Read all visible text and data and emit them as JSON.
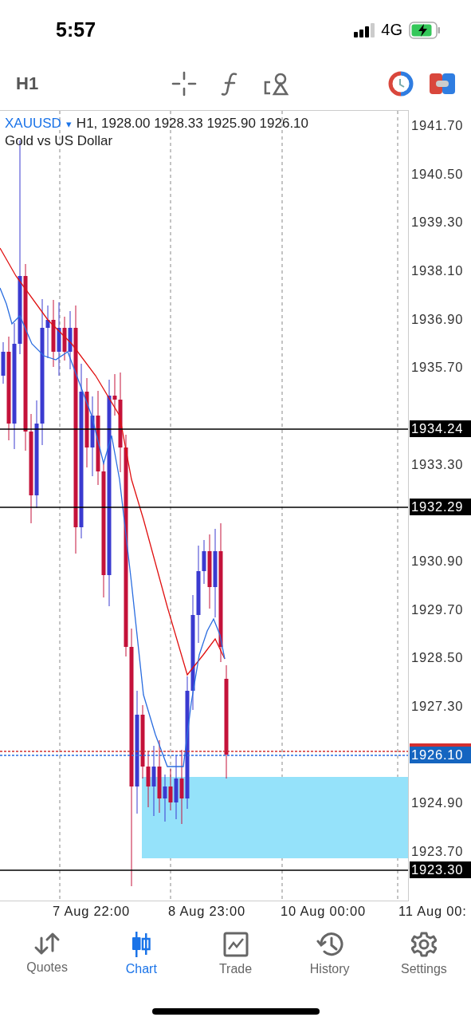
{
  "status_bar": {
    "time": "5:57",
    "network": "4G"
  },
  "toolbar": {
    "timeframe": "H1"
  },
  "chart": {
    "symbol": "XAUUSD",
    "dropdown": "▾",
    "quote": "H1, 1928.00 1928.33 1925.90 1926.10",
    "description": "Gold vs US Dollar",
    "price_ticks": [
      "1941.70",
      "1940.50",
      "1939.30",
      "1938.10",
      "1936.90",
      "1935.70",
      "1933.30",
      "1930.90",
      "1929.70",
      "1928.50",
      "1927.30",
      "1924.90",
      "1923.70"
    ],
    "price_markers": [
      {
        "label": "1934.24",
        "kind": "line"
      },
      {
        "label": "1932.29",
        "kind": "line"
      },
      {
        "label": "1926.10",
        "kind": "bid"
      },
      {
        "label": "1923.30",
        "kind": "line"
      }
    ],
    "time_ticks": [
      "7 Aug 22:00",
      "8 Aug 23:00",
      "10 Aug 00:00",
      "11 Aug 00:"
    ]
  },
  "tabs": [
    {
      "label": "Quotes",
      "selected": false
    },
    {
      "label": "Chart",
      "selected": true
    },
    {
      "label": "Trade",
      "selected": false
    },
    {
      "label": "History",
      "selected": false
    },
    {
      "label": "Settings",
      "selected": false
    }
  ]
}
